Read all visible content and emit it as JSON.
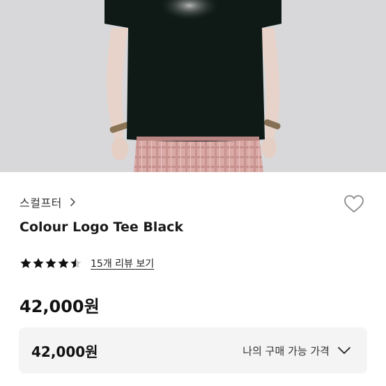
{
  "product": {
    "brand": "스컬프터",
    "name": "Colour Logo Tee Black",
    "rating": 4.5,
    "rating_max": 5,
    "review_link": "15개 리뷰 보기",
    "price": "42,000원"
  },
  "price_panel": {
    "price": "42,000원",
    "label": "나의 구매 가능 가격"
  },
  "icons": {
    "brand_chevron": "chevron-right-icon",
    "wishlist": "heart-outline-icon",
    "panel_chevron": "chevron-down-icon"
  },
  "colors": {
    "text": "#111111",
    "panel_bg": "#f4f4f5"
  }
}
